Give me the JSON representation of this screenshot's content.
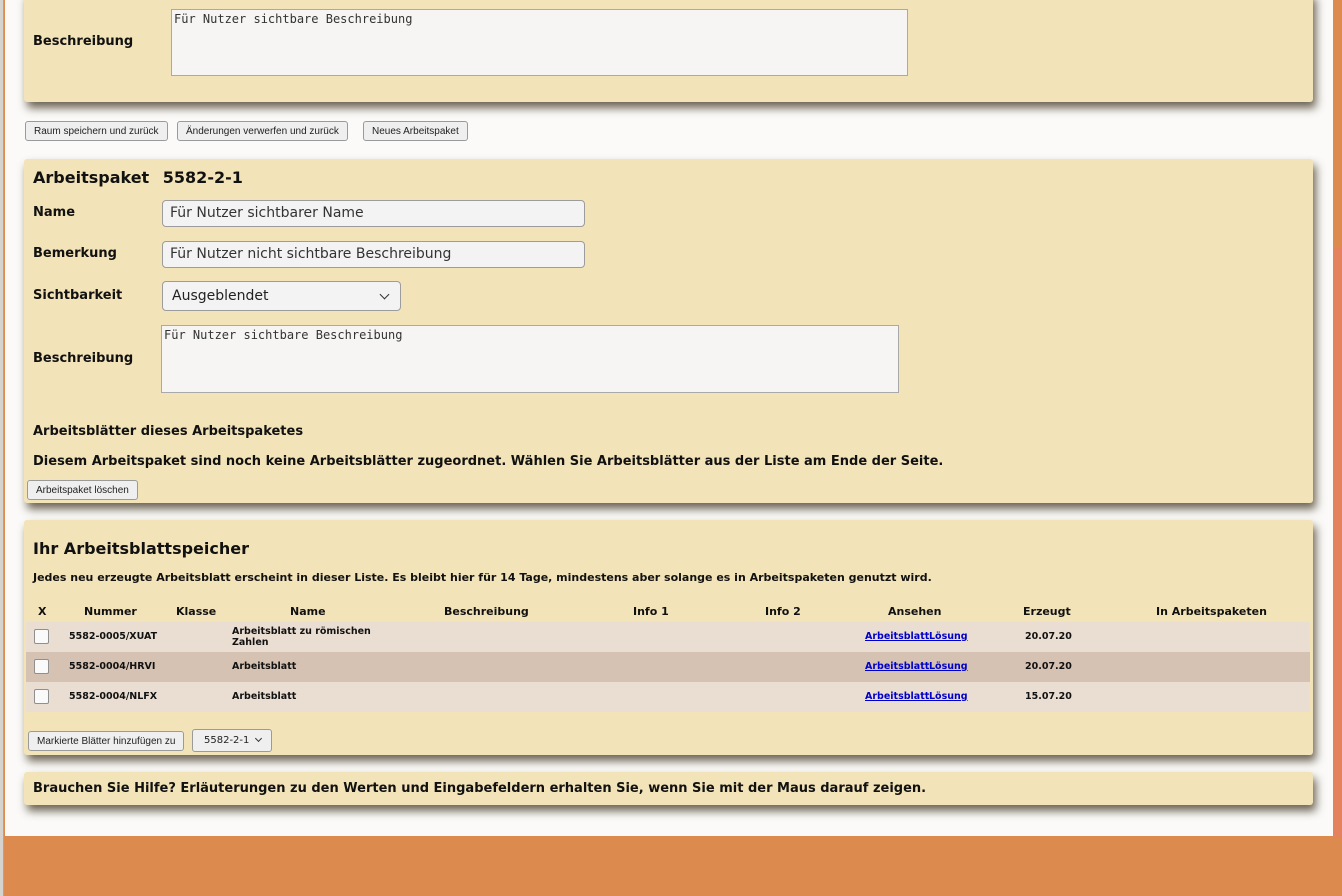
{
  "top_panel": {
    "beschreibung_label": "Beschreibung",
    "beschreibung_value": "Für Nutzer sichtbare Beschreibung"
  },
  "actions": {
    "save": "Raum speichern und zurück",
    "discard": "Änderungen verwerfen und zurück",
    "new_package": "Neues Arbeitspaket"
  },
  "package": {
    "title_label": "Arbeitspaket",
    "id": "5582-2-1",
    "name_label": "Name",
    "name_value": "Für Nutzer sichtbarer Name",
    "bemerkung_label": "Bemerkung",
    "bemerkung_value": "Für Nutzer nicht sichtbare Beschreibung",
    "sichtbarkeit_label": "Sichtbarkeit",
    "sichtbarkeit_value": "Ausgeblendet",
    "beschreibung_label": "Beschreibung",
    "beschreibung_value": "Für Nutzer sichtbare Beschreibung",
    "sheets_heading": "Arbeitsblätter dieses Arbeitspaketes",
    "empty_message": "Diesem Arbeitspaket sind noch keine Arbeitsblätter zugeordnet. Wählen Sie Arbeitsblätter aus der Liste am Ende der Seite.",
    "delete_button": "Arbeitspaket löschen"
  },
  "storage": {
    "title": "Ihr Arbeitsblattspeicher",
    "info": "Jedes neu erzeugte Arbeitsblatt erscheint in dieser Liste. Es bleibt hier für 14 Tage, mindestens aber solange es in Arbeitspaketen genutzt wird.",
    "columns": [
      "X",
      "Nummer",
      "Klasse",
      "Name",
      "Beschreibung",
      "Info 1",
      "Info 2",
      "Ansehen",
      "Erzeugt",
      "In Arbeitspaketen"
    ],
    "rows": [
      {
        "nummer": "5582-0005/XUAT",
        "klasse": "",
        "name_line1": "Arbeitsblatt zu römischen",
        "name_line2": "Zahlen",
        "beschreibung": "",
        "info1": "",
        "info2": "",
        "view_sheet": "Arbeitsblatt",
        "view_solution": "Lösung",
        "erzeugt": "20.07.20",
        "in_pakete": ""
      },
      {
        "nummer": "5582-0004/HRVI",
        "klasse": "",
        "name_line1": "Arbeitsblatt",
        "name_line2": "",
        "beschreibung": "",
        "info1": "",
        "info2": "",
        "view_sheet": "Arbeitsblatt",
        "view_solution": "Lösung",
        "erzeugt": "20.07.20",
        "in_pakete": ""
      },
      {
        "nummer": "5582-0004/NLFX",
        "klasse": "",
        "name_line1": "Arbeitsblatt",
        "name_line2": "",
        "beschreibung": "",
        "info1": "",
        "info2": "",
        "view_sheet": "Arbeitsblatt",
        "view_solution": "Lösung",
        "erzeugt": "15.07.20",
        "in_pakete": ""
      }
    ],
    "add_button": "Markierte Blätter hinzufügen zu",
    "target_value": "5582-2-1"
  },
  "help": {
    "text": "Brauchen Sie Hilfe? Erläuterungen zu den Werten und Eingabefeldern erhalten Sie, wenn Sie mit der Maus darauf zeigen."
  },
  "colors": {
    "panel": "#f2e3b8",
    "row_light": "#eaded2",
    "row_dark": "#d5c2b2",
    "footer": "#dc8a4e"
  }
}
